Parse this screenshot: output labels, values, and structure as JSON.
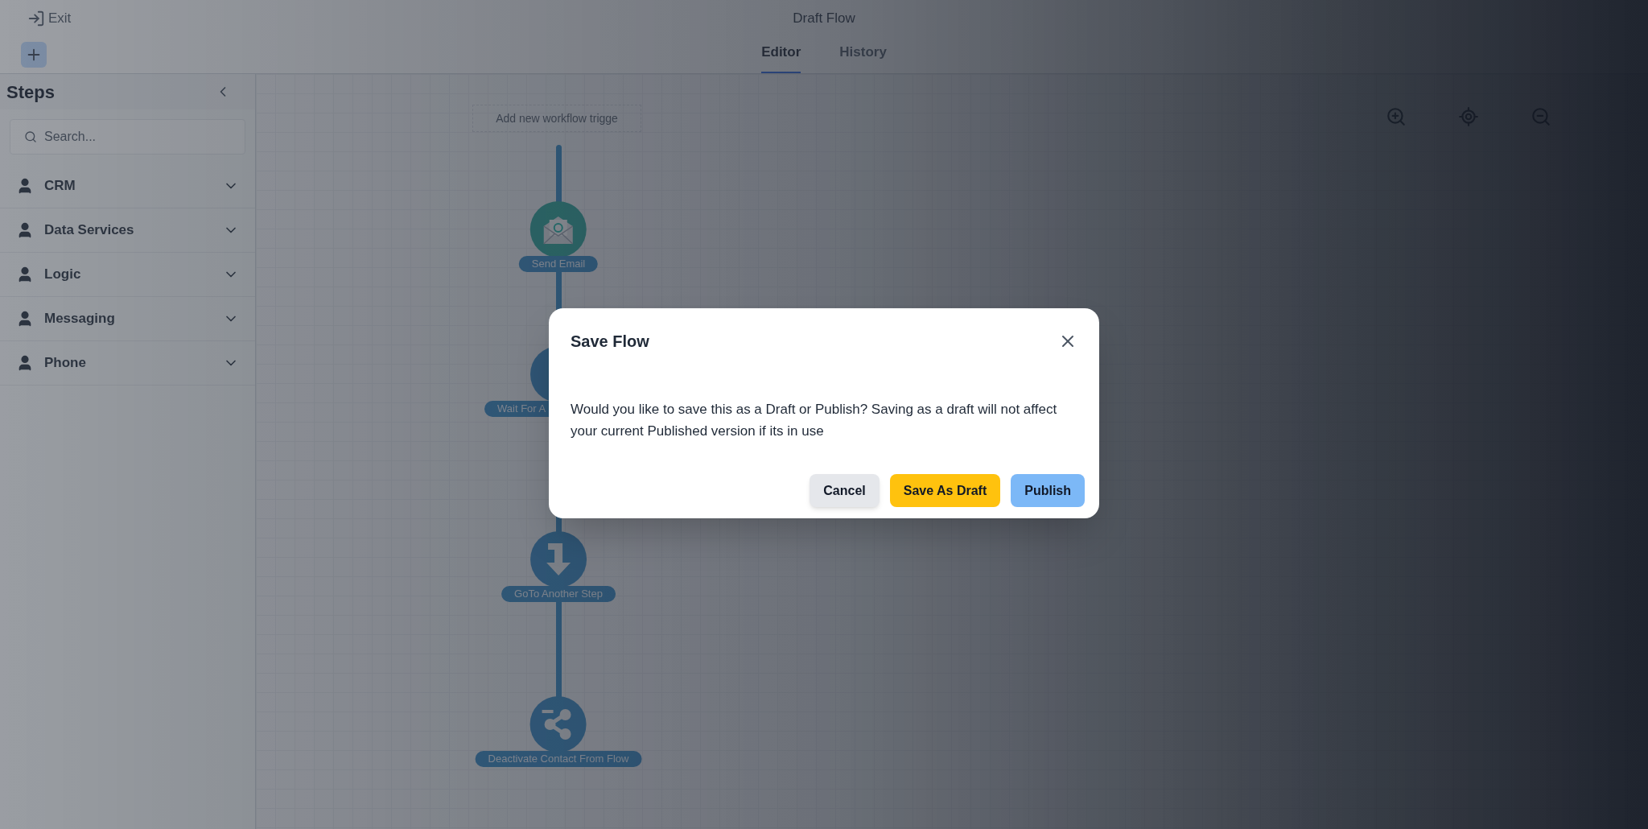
{
  "header": {
    "exit_label": "Exit",
    "title": "Draft Flow",
    "tabs": [
      {
        "label": "Editor",
        "selected": true
      },
      {
        "label": "History",
        "selected": false
      }
    ]
  },
  "sidebar": {
    "title": "Steps",
    "search": {
      "placeholder": "Search..."
    },
    "categories": [
      {
        "label": "CRM",
        "expanded": false
      },
      {
        "label": "Data Services",
        "expanded": false
      },
      {
        "label": "Logic",
        "expanded": false
      },
      {
        "label": "Messaging",
        "expanded": false
      },
      {
        "label": "Phone",
        "expanded": false
      }
    ]
  },
  "canvas": {
    "trigger_placeholder": "Add new workflow trigge",
    "steps": [
      {
        "kind": "email",
        "label": "Send Email"
      },
      {
        "kind": "wait",
        "label": "Wait For A"
      },
      {
        "kind": "goto",
        "label": "GoTo Another Step"
      },
      {
        "kind": "deactivate",
        "label": "Deactivate Contact From Flow"
      }
    ]
  },
  "dialog": {
    "title": "Save Flow",
    "message": "Would you like to save this as a Draft or Publish? Saving as a draft will not affect your current Published version if its in use",
    "buttons": [
      {
        "kind": "secondary",
        "label": "Cancel"
      },
      {
        "kind": "draft",
        "label": "Save As Draft"
      },
      {
        "kind": "primary",
        "label": "Publish"
      }
    ]
  }
}
